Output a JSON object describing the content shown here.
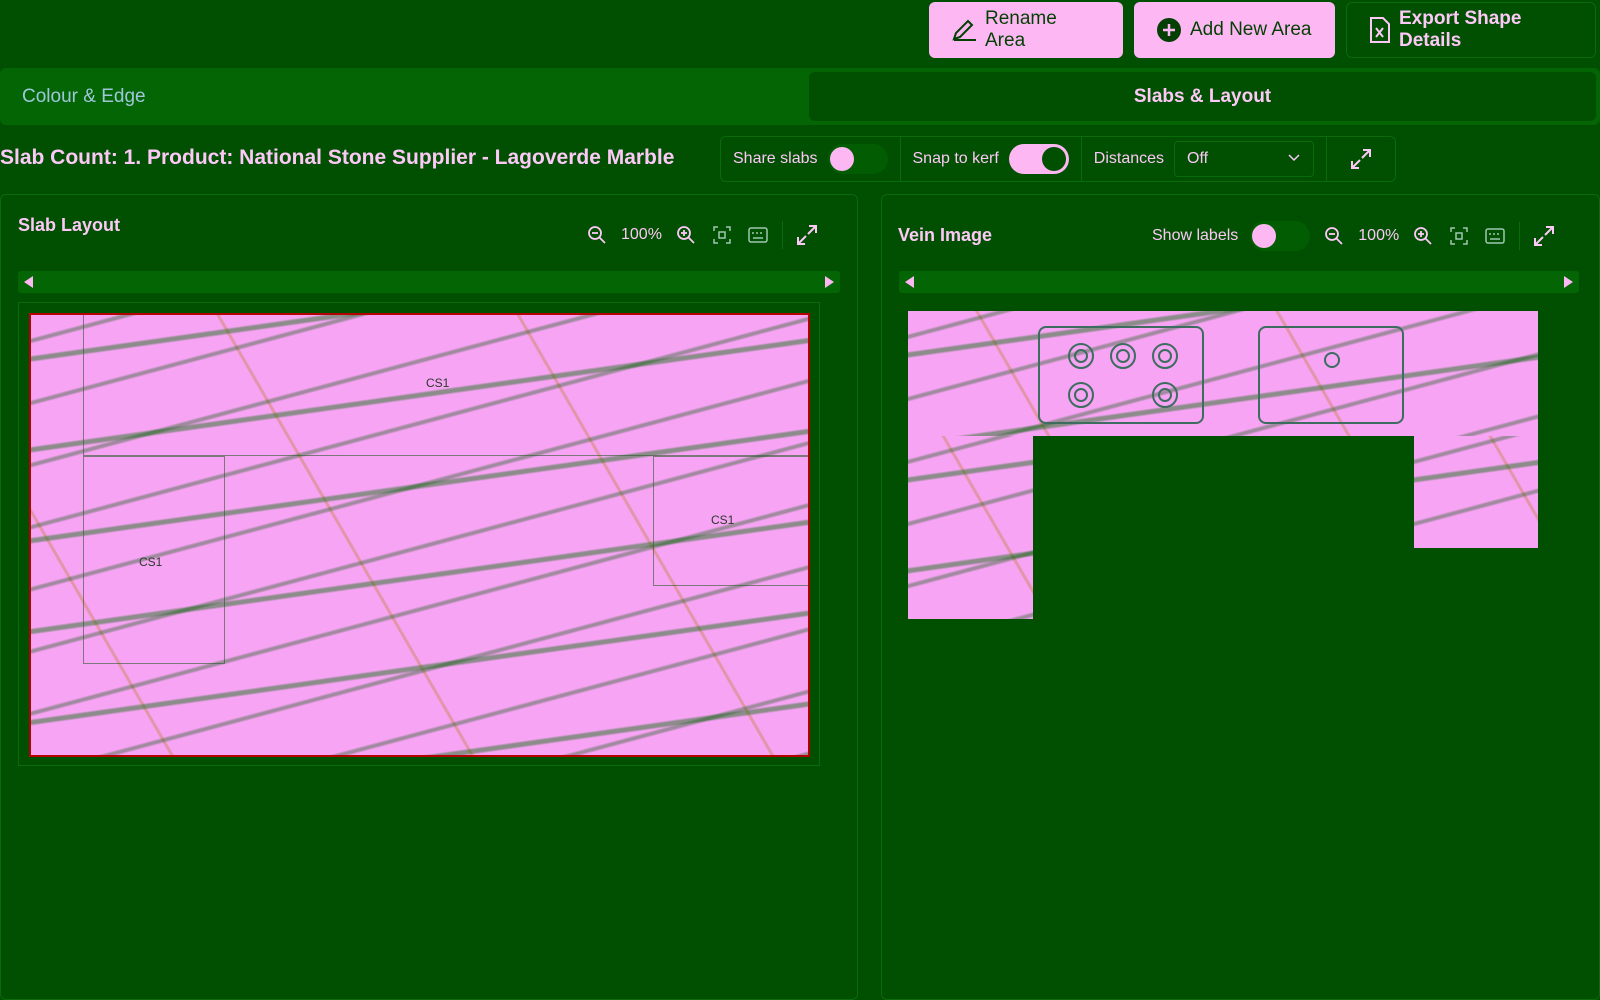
{
  "toolbar": {
    "rename_label": "Rename Area",
    "add_label": "Add New Area",
    "export_label": "Export Shape Details"
  },
  "tabs": [
    {
      "label": "Colour & Edge",
      "active": false
    },
    {
      "label": "Slabs & Layout",
      "active": true
    }
  ],
  "product": {
    "title": "Slab Count:  1. Product:  National Stone Supplier - Lagoverde Marble"
  },
  "settings": {
    "share_slabs_label": "Share slabs",
    "share_slabs_on": false,
    "snap_label": "Snap to kerf",
    "snap_on": true,
    "distances_label": "Distances",
    "distances_value": "Off"
  },
  "slab_panel": {
    "title": "Slab Layout",
    "zoom": "100%",
    "pieces": [
      "CS1",
      "CS1",
      "CS1"
    ]
  },
  "vein_panel": {
    "title": "Vein Image",
    "show_labels_label": "Show labels",
    "show_labels_on": false,
    "zoom": "100%"
  },
  "colors": {
    "background": "#014f01",
    "accent": "#fdb8f3",
    "slab_border": "#b30000"
  }
}
